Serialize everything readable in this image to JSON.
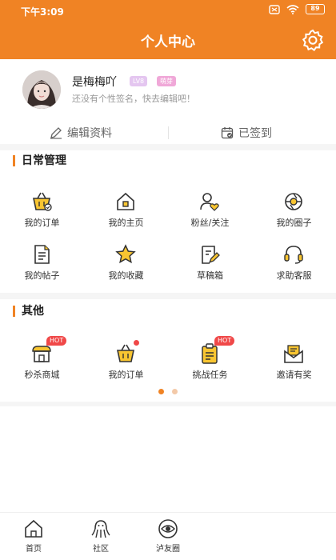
{
  "status_bar": {
    "time": "下午3:09",
    "battery": "89"
  },
  "header": {
    "title": "个人中心"
  },
  "profile": {
    "name": "是梅梅吖",
    "level_badge": "LV8",
    "tag_badge": "萌芽",
    "signature": "还没有个性签名，快去编辑吧！",
    "edit_label": "编辑资料",
    "signin_label": "已签到"
  },
  "daily": {
    "title": "日常管理",
    "items": [
      {
        "label": "我的订单",
        "icon": "basket-icon"
      },
      {
        "label": "我的主页",
        "icon": "home-icon"
      },
      {
        "label": "粉丝/关注",
        "icon": "user-heart-icon"
      },
      {
        "label": "我的圈子",
        "icon": "aperture-icon"
      },
      {
        "label": "我的帖子",
        "icon": "document-icon"
      },
      {
        "label": "我的收藏",
        "icon": "star-icon"
      },
      {
        "label": "草稿箱",
        "icon": "draft-icon"
      },
      {
        "label": "求助客服",
        "icon": "headset-icon"
      }
    ]
  },
  "other": {
    "title": "其他",
    "hot_badge": "HOT",
    "items": [
      {
        "label": "秒杀商城",
        "icon": "shop-icon"
      },
      {
        "label": "我的订单",
        "icon": "basket-icon"
      },
      {
        "label": "挑战任务",
        "icon": "clipboard-icon"
      },
      {
        "label": "邀请有奖",
        "icon": "envelope-icon"
      }
    ]
  },
  "tabbar": {
    "items": [
      {
        "label": "首页",
        "icon": "home-icon"
      },
      {
        "label": "社区",
        "icon": "octopus-icon"
      },
      {
        "label": "泸友圈",
        "icon": "eye-circle-icon"
      }
    ]
  },
  "colors": {
    "accent": "#f08324",
    "hot": "#f04848"
  }
}
